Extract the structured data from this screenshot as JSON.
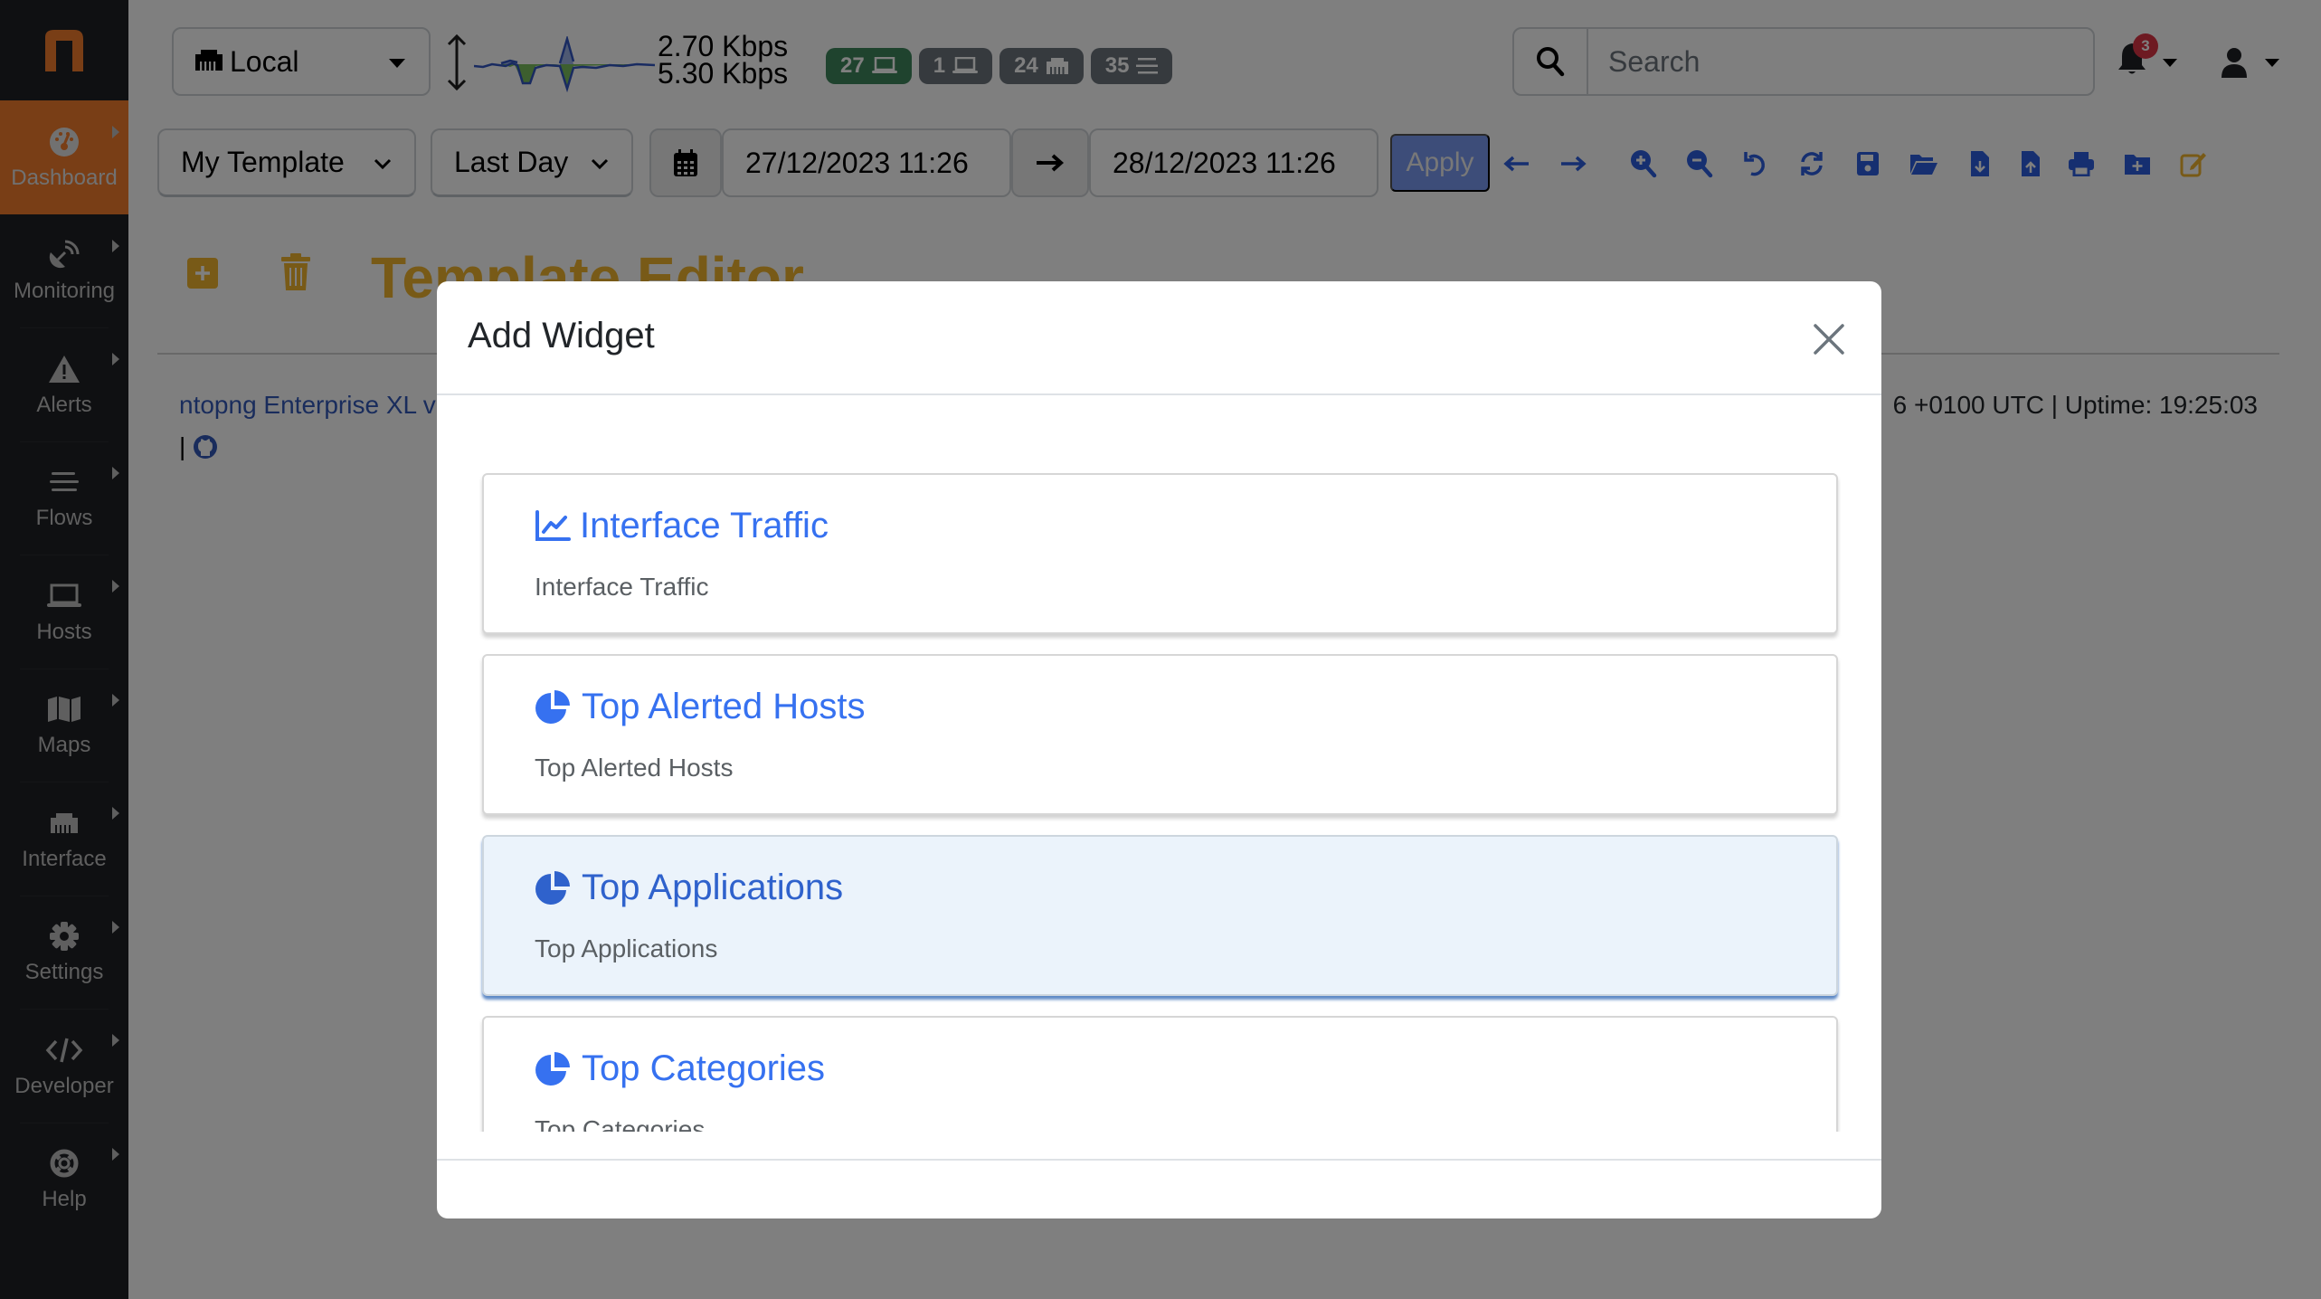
{
  "sidebar": {
    "items": [
      {
        "label": "Dashboard",
        "icon": "dashboard-gauge-icon",
        "active": true
      },
      {
        "label": "Monitoring",
        "icon": "satellite-dish-icon"
      },
      {
        "label": "Alerts",
        "icon": "warning-triangle-icon"
      },
      {
        "label": "Flows",
        "icon": "bars-icon"
      },
      {
        "label": "Hosts",
        "icon": "laptop-icon"
      },
      {
        "label": "Maps",
        "icon": "map-icon"
      },
      {
        "label": "Interface",
        "icon": "ethernet-icon"
      },
      {
        "label": "Settings",
        "icon": "gear-icon"
      },
      {
        "label": "Developer",
        "icon": "code-icon"
      },
      {
        "label": "Help",
        "icon": "life-ring-icon"
      }
    ]
  },
  "topbar": {
    "interface": "Local",
    "upload_rate": "2.70 Kbps",
    "download_rate": "5.30 Kbps",
    "badges": [
      {
        "count": "27",
        "icon": "laptop-icon",
        "color": "#3f875c"
      },
      {
        "count": "1",
        "icon": "laptop-icon",
        "color": "#6c757d"
      },
      {
        "count": "24",
        "icon": "ethernet-icon",
        "color": "#6c757d"
      },
      {
        "count": "35",
        "icon": "bars-icon",
        "color": "#6c757d"
      }
    ],
    "search_placeholder": "Search",
    "notification_count": "3"
  },
  "toolbar": {
    "template": "My Template",
    "range": "Last Day",
    "from": "27/12/2023 11:26",
    "to": "28/12/2023 11:26",
    "apply_label": "Apply"
  },
  "editor": {
    "title": "Template Editor",
    "product_info": "ntopng Enterprise XL v",
    "uptime_info": "6 +0100 UTC | Uptime: 19:25:03",
    "separator": "|"
  },
  "modal": {
    "title": "Add Widget",
    "widgets": [
      {
        "title": "Interface Traffic",
        "description": "Interface Traffic",
        "icon": "line-chart-icon",
        "selected": false
      },
      {
        "title": "Top Alerted Hosts",
        "description": "Top Alerted Hosts",
        "icon": "pie-chart-icon",
        "selected": false
      },
      {
        "title": "Top Applications",
        "description": "Top Applications",
        "icon": "pie-chart-icon",
        "selected": true
      },
      {
        "title": "Top Categories",
        "description": "Top Categories",
        "icon": "pie-chart-icon",
        "selected": false
      }
    ]
  },
  "colors": {
    "brand_orange": "#f37c2d",
    "link_blue": "#3671f0",
    "editor_gold": "#f0b52e",
    "sidebar_bg": "#1e2024"
  }
}
